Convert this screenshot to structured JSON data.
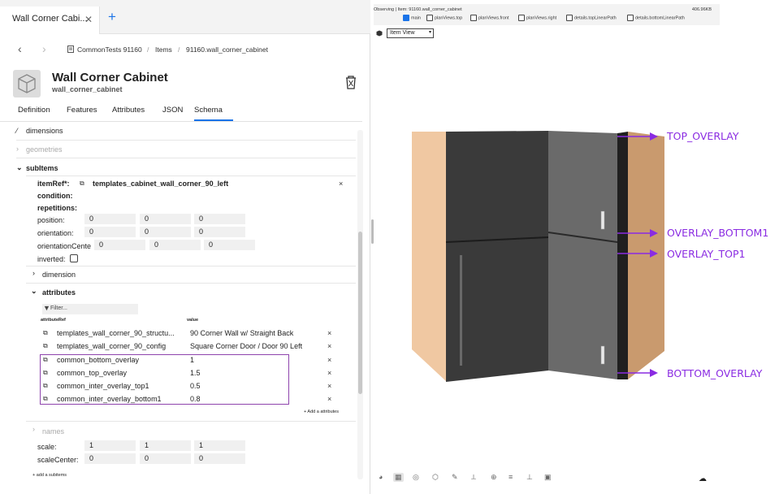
{
  "tab": {
    "title": "Wall Corner Cabi...",
    "close": "✕",
    "add": "+"
  },
  "breadcrumb": {
    "root": "CommonTests 91160",
    "items": "Items",
    "current": "91160.wall_corner_cabinet",
    "sep": "/"
  },
  "header": {
    "title": "Wall Corner Cabinet",
    "subtitle": "wall_corner_cabinet"
  },
  "tabs": [
    "Definition",
    "Features",
    "Attributes",
    "JSON",
    "Schema"
  ],
  "active_tab": "Schema",
  "schema": {
    "dimensions": "dimensions",
    "geometries": "geometries",
    "subitems": "subItems",
    "itemref_label": "itemRef*:",
    "itemref_value": "templates_cabinet_wall_corner_90_left",
    "condition": "condition:",
    "repetitions": "repetitions:",
    "position_label": "position:",
    "position": [
      "0",
      "0",
      "0"
    ],
    "orientation_label": "orientation:",
    "orientation": [
      "0",
      "0",
      "0"
    ],
    "orientation_center_label": "orientationCente",
    "orientation_center": [
      "0",
      "0",
      "0"
    ],
    "inverted": "inverted:",
    "dimension": "dimension",
    "attributes": "attributes",
    "filter_placeholder": "Filter...",
    "col_ref": "attributeRef",
    "col_value": "value",
    "rows": [
      {
        "ref": "templates_wall_corner_90_structu...",
        "value": "90 Corner Wall w/ Straight Back"
      },
      {
        "ref": "templates_wall_corner_90_config",
        "value": "Square Corner Door / Door 90 Left"
      },
      {
        "ref": "common_bottom_overlay",
        "value": "1"
      },
      {
        "ref": "common_top_overlay",
        "value": "1.5"
      },
      {
        "ref": "common_inter_overlay_top1",
        "value": "0.5"
      },
      {
        "ref": "common_inter_overlay_bottom1",
        "value": "0.8"
      }
    ],
    "add_attributes": "+ Add a attributes",
    "names": "names",
    "scale_label": "scale:",
    "scale": [
      "1",
      "1",
      "1"
    ],
    "scale_center_label": "scaleCenter:",
    "scale_center": [
      "0",
      "0",
      "0"
    ],
    "add_subitems": "+ add a subitems"
  },
  "viewer": {
    "observing": "Observing | Item: 91160.wall_corner_cabinet",
    "size": "406.96KB",
    "views": [
      {
        "label": "main",
        "checked": true
      },
      {
        "label": "planViews.top",
        "checked": false
      },
      {
        "label": "planViews.front",
        "checked": false
      },
      {
        "label": "planViews.right",
        "checked": false
      },
      {
        "label": "details.topLinearPath",
        "checked": false
      },
      {
        "label": "details.bottomLinearPath",
        "checked": false
      }
    ],
    "view_select": "Item View",
    "annotations": [
      "TOP_OVERLAY",
      "OVERLAY_BOTTOM1",
      "OVERLAY_TOP1",
      "BOTTOM_OVERLAY"
    ]
  },
  "colors": {
    "accent": "#1a73e8",
    "annotation": "#8a2be2",
    "highlight_box": "#8e44ad"
  }
}
